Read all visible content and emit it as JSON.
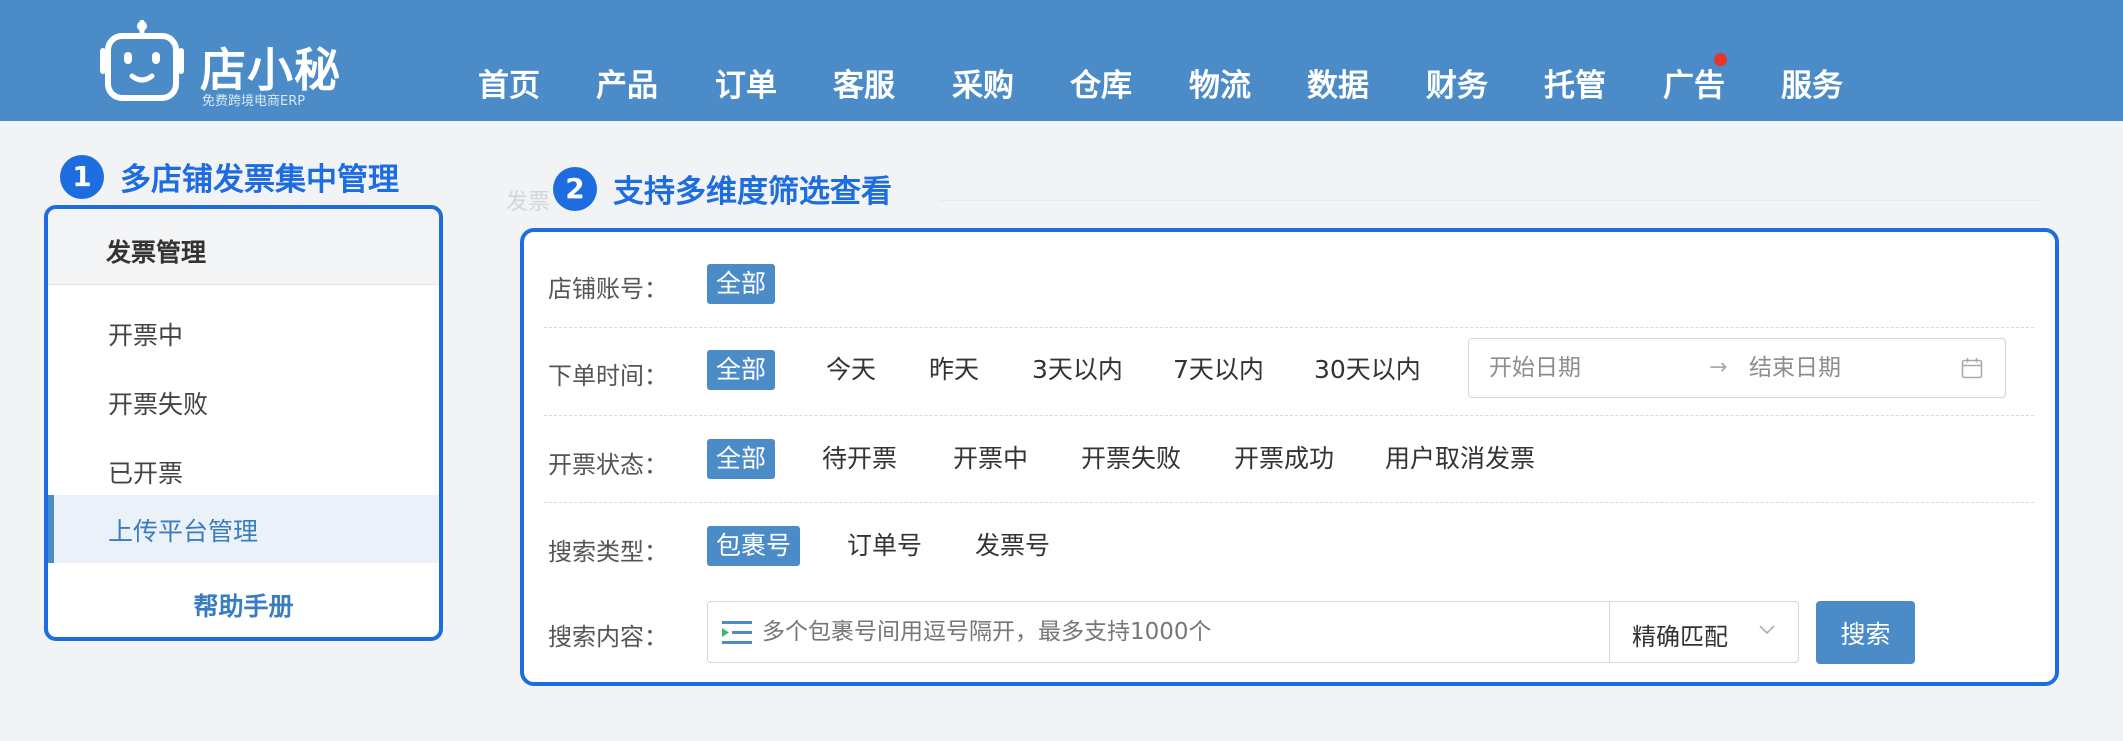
{
  "header": {
    "logo_name": "店小秘",
    "logo_sub": "免费跨境电商ERP",
    "nav": [
      "首页",
      "产品",
      "订单",
      "客服",
      "采购",
      "仓库",
      "物流",
      "数据",
      "财务",
      "托管",
      "广告",
      "服务"
    ],
    "notification_item": "广告",
    "colors": {
      "bar": "#4a8bc8",
      "dot": "#e8332f"
    }
  },
  "callouts": [
    {
      "number": "1",
      "text": "多店铺发票集中管理"
    },
    {
      "number": "2",
      "text": "支持多维度筛选查看"
    }
  ],
  "faded_label": "发票",
  "sidebar": {
    "title": "发票管理",
    "items": [
      "开票中",
      "开票失败",
      "已开票",
      "上传平台管理"
    ],
    "active": "上传平台管理",
    "help": "帮助手册"
  },
  "filters": {
    "shop": {
      "label": "店铺账号：",
      "options": [
        "全部"
      ],
      "selected": "全部"
    },
    "order_time": {
      "label": "下单时间：",
      "options": [
        "全部",
        "今天",
        "昨天",
        "3天以内",
        "7天以内",
        "30天以内"
      ],
      "selected": "全部",
      "start_placeholder": "开始日期",
      "end_placeholder": "结束日期"
    },
    "invoice_status": {
      "label": "开票状态：",
      "options": [
        "全部",
        "待开票",
        "开票中",
        "开票失败",
        "开票成功",
        "用户取消发票"
      ],
      "selected": "全部"
    },
    "search_type": {
      "label": "搜索类型：",
      "options": [
        "包裹号",
        "订单号",
        "发票号"
      ],
      "selected": "包裹号"
    },
    "search_content": {
      "label": "搜索内容：",
      "placeholder": "多个包裹号间用逗号隔开，最多支持1000个",
      "match_mode": "精确匹配",
      "button": "搜索"
    }
  },
  "accent_color": "#1e6de0"
}
